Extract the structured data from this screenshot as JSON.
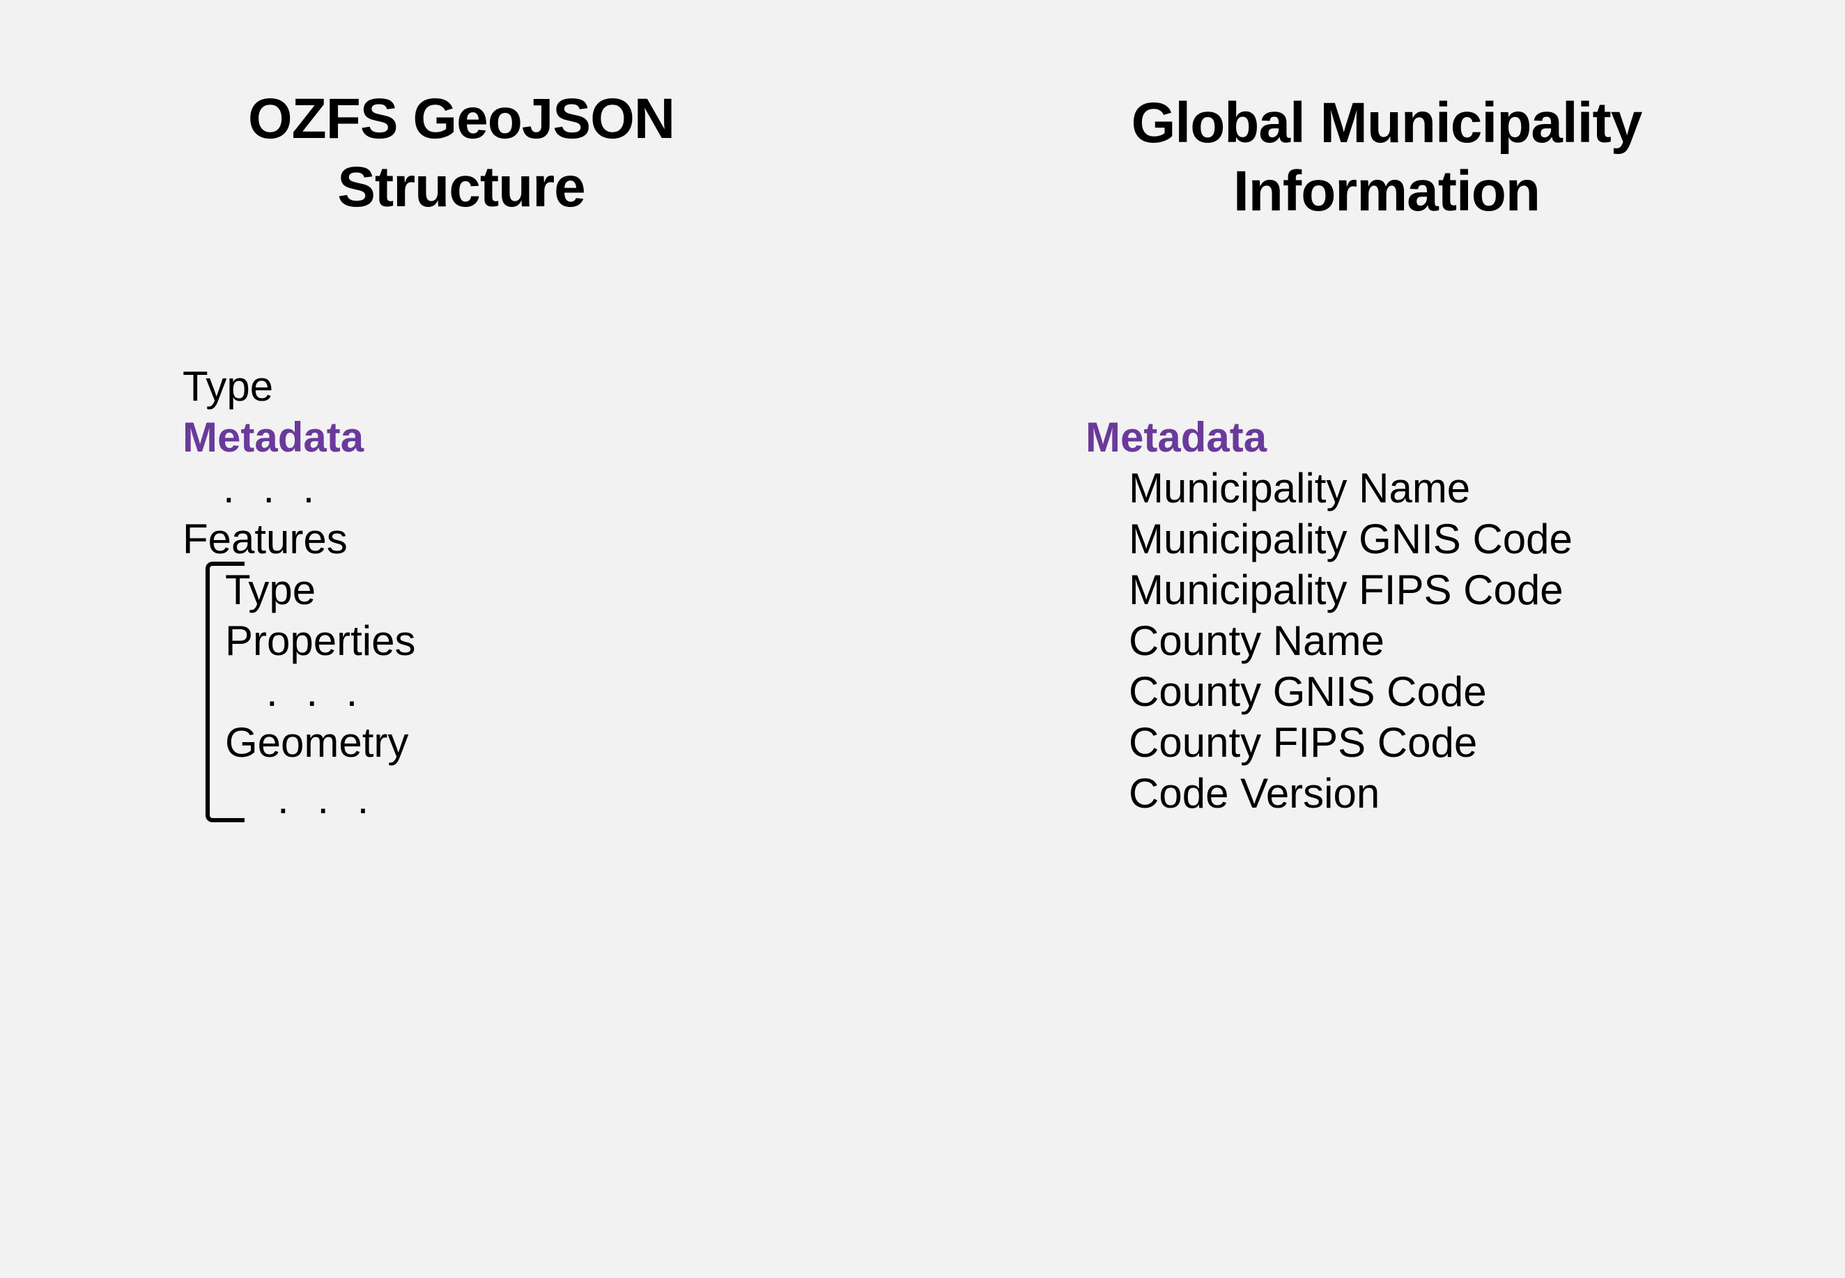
{
  "left": {
    "title": "OZFS GeoJSON Structure",
    "type_label": "Type",
    "metadata_label": "Metadata",
    "metadata_ellipsis": ". . .",
    "features_label": "Features",
    "feature_type_label": "Type",
    "properties_label": "Properties",
    "properties_ellipsis": ". . .",
    "geometry_label": "Geometry",
    "geometry_ellipsis": ". . ."
  },
  "right": {
    "title": "Global Municipality Information",
    "metadata_label": "Metadata",
    "fields": [
      "Municipality Name",
      "Municipality GNIS Code",
      "Municipality FIPS Code",
      "County Name",
      "County GNIS Code",
      "County FIPS Code",
      "Code Version"
    ]
  },
  "colors": {
    "highlight": "#6a3a9b",
    "background": "#f2f2f2",
    "text": "#000000"
  }
}
